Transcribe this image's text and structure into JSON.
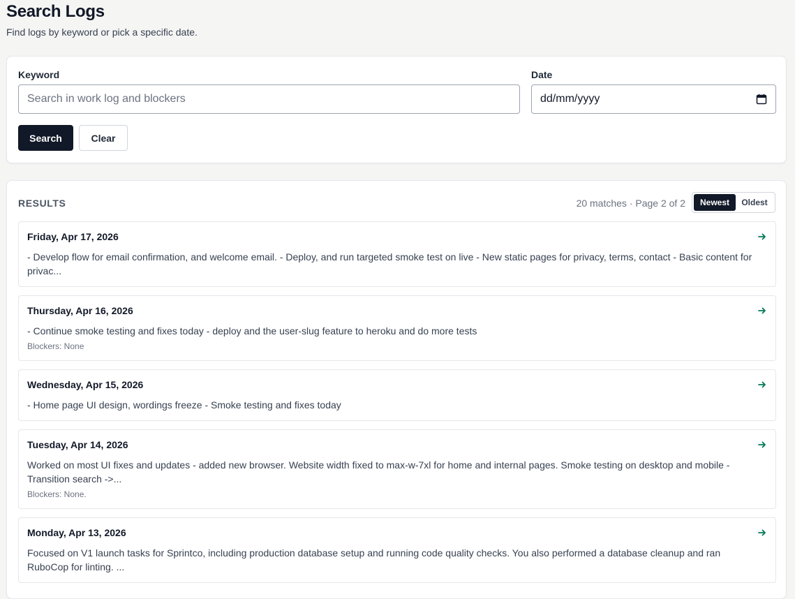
{
  "header": {
    "title": "Search Logs",
    "subtitle": "Find logs by keyword or pick a specific date."
  },
  "search": {
    "keyword_label": "Keyword",
    "keyword_placeholder": "Search in work log and blockers",
    "keyword_value": "",
    "date_label": "Date",
    "date_placeholder": "dd/mm/yyyy",
    "search_button": "Search",
    "clear_button": "Clear"
  },
  "results": {
    "heading": "RESULTS",
    "meta": "20 matches · Page 2 of 2",
    "sort": {
      "newest": "Newest",
      "oldest": "Oldest",
      "active": "Newest"
    },
    "accent_color": "#047857",
    "items": [
      {
        "date": "Friday, Apr 17, 2026",
        "summary": "- Develop flow for email confirmation, and welcome email. - Deploy, and run targeted smoke test on live - New static pages for privacy, terms, contact - Basic content for privac...",
        "blockers": ""
      },
      {
        "date": "Thursday, Apr 16, 2026",
        "summary": "- Continue smoke testing and fixes today - deploy and the user-slug feature to heroku and do more tests",
        "blockers": "Blockers: None"
      },
      {
        "date": "Wednesday, Apr 15, 2026",
        "summary": "- Home page UI design, wordings freeze - Smoke testing and fixes today",
        "blockers": ""
      },
      {
        "date": "Tuesday, Apr 14, 2026",
        "summary": "Worked on most UI fixes and updates - added new browser. Website width fixed to max-w-7xl for home and internal pages. Smoke testing on desktop and mobile - Transition search ->...",
        "blockers": "Blockers: None."
      },
      {
        "date": "Monday, Apr 13, 2026",
        "summary": "Focused on V1 launch tasks for Sprintco, including production database setup and running code quality checks. You also performed a database cleanup and ran RuboCop for linting. ...",
        "blockers": ""
      }
    ]
  }
}
